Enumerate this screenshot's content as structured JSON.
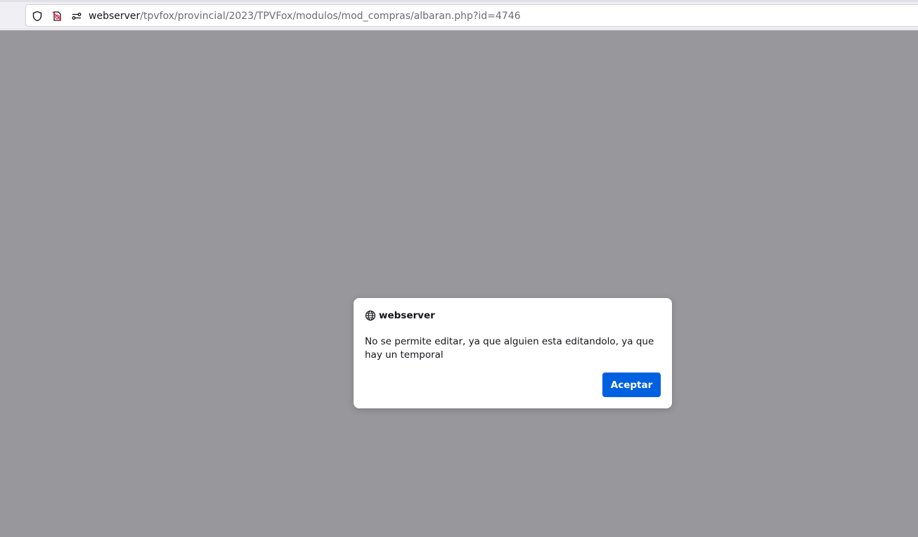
{
  "browser": {
    "url_host": "webserver",
    "url_path": "/tpvfox/provincial/2023/TPVFox/modulos/mod_compras/albaran.php?id=4746",
    "icons": [
      "shield-icon",
      "no-mic-permission-icon",
      "site-permissions-icon"
    ]
  },
  "dialog": {
    "origin": "webserver",
    "message": "No se permite editar, ya que alguien esta editandolo, ya que hay un temporal",
    "accept_label": "Aceptar"
  },
  "colors": {
    "overlay": "#98989c",
    "accent": "#0061e0"
  }
}
